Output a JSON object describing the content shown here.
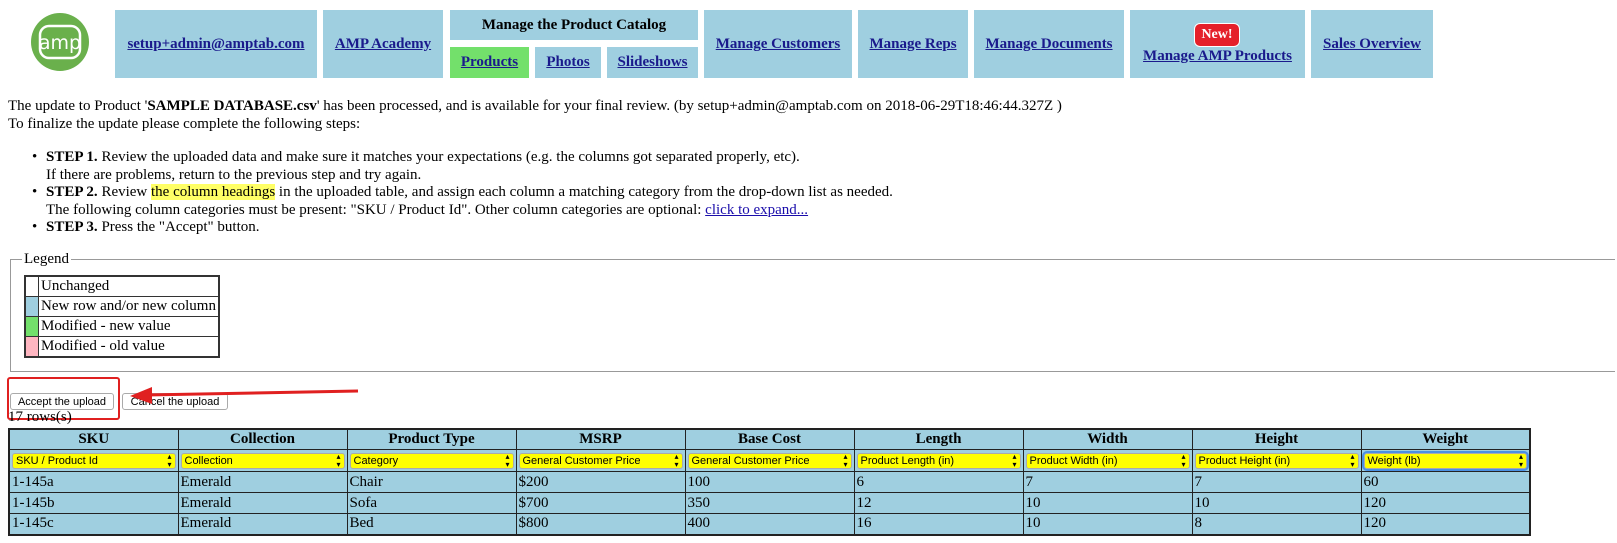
{
  "nav": {
    "logo_text": "amp",
    "user": "setup+admin@amptab.com",
    "academy": "AMP Academy",
    "catalog_title": "Manage the Product Catalog",
    "catalog_products": "Products",
    "catalog_photos": "Photos",
    "catalog_slideshows": "Slideshows",
    "customers": "Manage Customers",
    "reps": "Manage Reps",
    "documents": "Manage Documents",
    "new_badge": "New!",
    "amp_products": "Manage AMP Products",
    "sales": "Sales Overview"
  },
  "intro": {
    "prefix": "The update to Product '",
    "filename": "SAMPLE DATABASE.csv",
    "suffix": "' has been processed, and is available for your final review. (by setup+admin@amptab.com on 2018-06-29T18:46:44.327Z )",
    "line2": "To finalize the update please complete the following steps:"
  },
  "steps": {
    "s1_label": "STEP 1.",
    "s1_text": " Review the uploaded data and make sure it matches your expectations (e.g. the columns got separated properly, etc).",
    "s1_text2": "If there are problems, return to the previous step and try again.",
    "s2_label": "STEP 2.",
    "s2_pre": " Review ",
    "s2_hl": "the column headings",
    "s2_post": " in the uploaded table, and assign each column a matching category from the drop-down list as needed.",
    "s2_text2": "The following column categories must be present: \"SKU / Product Id\". Other column categories are optional: ",
    "s2_link": "click to expand...",
    "s3_label": "STEP 3.",
    "s3_text": " Press the \"Accept\" button."
  },
  "legend": {
    "title": "Legend",
    "items": [
      {
        "label": "Unchanged",
        "color": "#ffffff"
      },
      {
        "label": "New row and/or new column",
        "color": "#9fcfe0"
      },
      {
        "label": "Modified - new value",
        "color": "#73e06b"
      },
      {
        "label": "Modified - old value",
        "color": "#ffb6c1"
      }
    ]
  },
  "buttons": {
    "accept": "Accept the upload",
    "cancel": "Cancel the upload"
  },
  "rowcount": "17 rows(s)",
  "table": {
    "headers": [
      "SKU",
      "Collection",
      "Product Type",
      "MSRP",
      "Base Cost",
      "Length",
      "Width",
      "Height",
      "Weight"
    ],
    "categories": [
      "SKU / Product Id",
      "Collection",
      "Category",
      "General Customer Price",
      "General Customer Price",
      "Product Length (in)",
      "Product Width (in)",
      "Product Height (in)",
      "Weight (lb)"
    ],
    "rows": [
      [
        "1-145a",
        "Emerald",
        "Chair",
        "$200",
        "100",
        "6",
        "7",
        "7",
        "60"
      ],
      [
        "1-145b",
        "Emerald",
        "Sofa",
        "$700",
        "350",
        "12",
        "10",
        "10",
        "120"
      ],
      [
        "1-145c",
        "Emerald",
        "Bed",
        "$800",
        "400",
        "16",
        "10",
        "8",
        "120"
      ]
    ]
  }
}
